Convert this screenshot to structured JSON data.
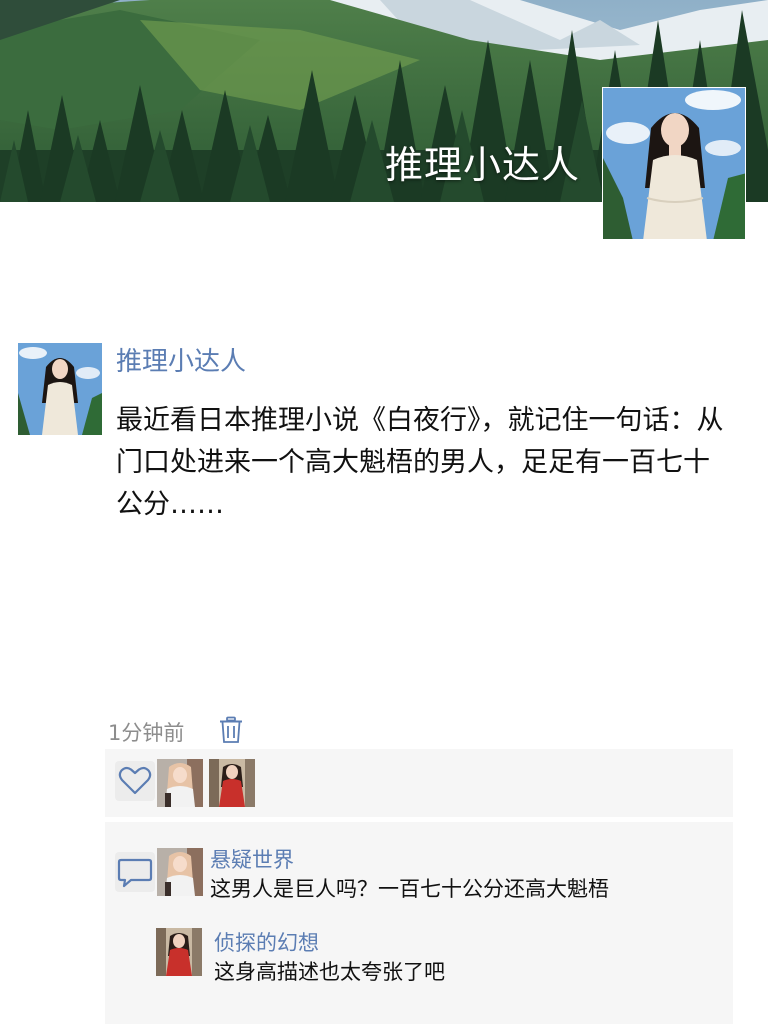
{
  "cover": {
    "title": "推理小达人",
    "image": "mountain-forest-landscape"
  },
  "post": {
    "author": "推理小达人",
    "text": "最近看日本推理小说《白夜行》，就记住一句话：从门口处进来一个高大魁梧的男人，足足有一百七十公分……",
    "time": "1分钟前"
  },
  "likes": {
    "icon": "heart-icon",
    "users": [
      "user-1",
      "user-2"
    ]
  },
  "comments": [
    {
      "author": "悬疑世界",
      "text": "这男人是巨人吗？一百七十公分还高大魁梧"
    },
    {
      "author": "侦探的幻想",
      "text": "这身高描述也太夸张了吧"
    }
  ],
  "colors": {
    "name_link": "#5b7db3",
    "panel_bg": "#f6f6f6",
    "time_gray": "#8d8d8d"
  }
}
